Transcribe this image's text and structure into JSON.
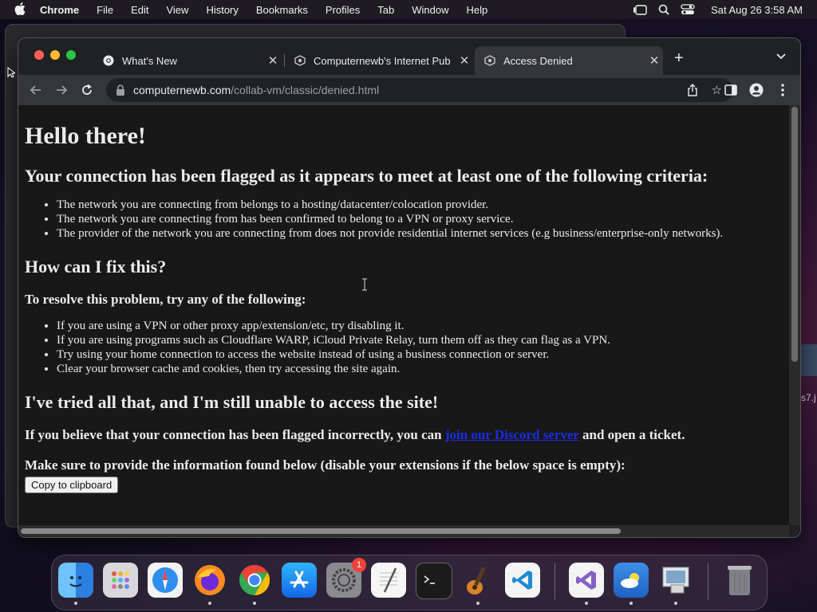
{
  "menubar": {
    "app_name": "Chrome",
    "items": [
      "File",
      "Edit",
      "View",
      "History",
      "Bookmarks",
      "Profiles",
      "Tab",
      "Window",
      "Help"
    ],
    "clock": "Sat Aug 26  3:58 AM"
  },
  "tabs": [
    {
      "title": "What's New",
      "icon": "chrome-icon",
      "active": false
    },
    {
      "title": "Computernewb's Internet Pub",
      "icon": "computernewb-icon",
      "active": false
    },
    {
      "title": "Access Denied",
      "icon": "computernewb-icon",
      "active": true
    }
  ],
  "address_bar": {
    "domain": "computernewb.com",
    "path": "/collab-vm/classic/denied.html"
  },
  "page": {
    "heading": "Hello there!",
    "flagged_heading": "Your connection has been flagged as it appears to meet at least one of the following criteria:",
    "criteria": [
      "The network you are connecting from belongs to a hosting/datacenter/colocation provider.",
      "The network you are connecting from has been confirmed to belong to a VPN or proxy service.",
      "The provider of the network you are connecting from does not provide residential internet services (e.g business/enterprise-only networks)."
    ],
    "fix_heading": "How can I fix this?",
    "resolve_heading": "To resolve this problem, try any of the following:",
    "fixes": [
      "If you are using a VPN or other proxy app/extension/etc, try disabling it.",
      "If you are using programs such as Cloudflare WARP, iCloud Private Relay, turn them off as they can flag as a VPN.",
      "Try using your home connection to access the website instead of using a business connection or server.",
      "Clear your browser cache and cookies, then try accessing the site again."
    ],
    "still_heading": "I've tried all that, and I'm still unable to access the site!",
    "ticket_before": "If you believe that your connection has been flagged incorrectly, you can ",
    "ticket_link": "join our Discord server",
    "ticket_after": " and open a ticket.",
    "info_text": "Make sure to provide the information found below (disable your extensions if the below space is empty):",
    "copy_button": "Copy to clipboard"
  },
  "background": {
    "side_label": "s7.j"
  },
  "dock": {
    "apps": [
      "finder-icon",
      "launchpad-icon",
      "safari-icon",
      "firefox-icon",
      "chrome-icon",
      "app-store-icon",
      "system-settings-icon",
      "textedit-icon",
      "terminal-icon",
      "garageband-icon",
      "vscode-icon",
      "visual-studio-icon",
      "weather-icon",
      "preview-icon",
      "trash-icon"
    ],
    "settings_badge": "1"
  },
  "colors": {
    "page_bg": "#181818",
    "link": "#1a2ce6",
    "chrome_dark": "#202124"
  }
}
